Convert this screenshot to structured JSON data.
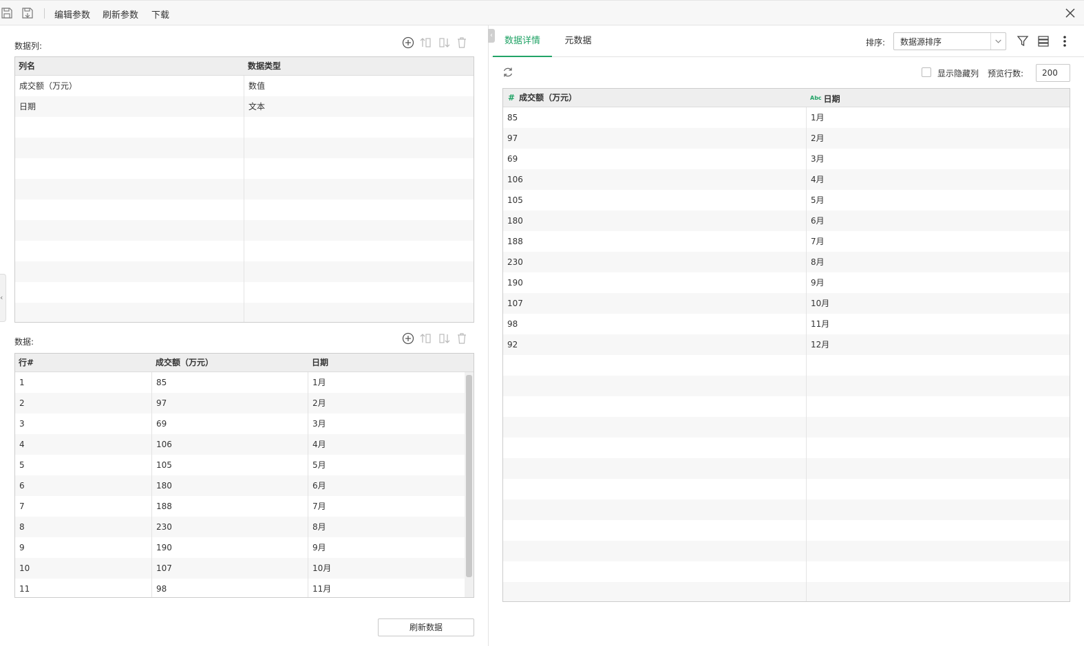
{
  "toolbar": {
    "save_icon": "save-icon",
    "save_as_icon": "save-as-icon",
    "edit_params": "编辑参数",
    "refresh_params": "刷新参数",
    "download": "下载"
  },
  "left": {
    "columns_label": "数据列:",
    "columns_header": [
      "列名",
      "数据类型"
    ],
    "columns_rows": [
      {
        "name": "成交额（万元）",
        "type": "数值"
      },
      {
        "name": "日期",
        "type": "文本"
      }
    ],
    "data_label": "数据:",
    "data_header": [
      "行#",
      "成交额（万元）",
      "日期"
    ],
    "data_rows": [
      {
        "row": "1",
        "amount": "85",
        "date": "1月"
      },
      {
        "row": "2",
        "amount": "97",
        "date": "2月"
      },
      {
        "row": "3",
        "amount": "69",
        "date": "3月"
      },
      {
        "row": "4",
        "amount": "106",
        "date": "4月"
      },
      {
        "row": "5",
        "amount": "105",
        "date": "5月"
      },
      {
        "row": "6",
        "amount": "180",
        "date": "6月"
      },
      {
        "row": "7",
        "amount": "188",
        "date": "7月"
      },
      {
        "row": "8",
        "amount": "230",
        "date": "8月"
      },
      {
        "row": "9",
        "amount": "190",
        "date": "9月"
      },
      {
        "row": "10",
        "amount": "107",
        "date": "10月"
      },
      {
        "row": "11",
        "amount": "98",
        "date": "11月"
      }
    ],
    "refresh_data_button": "刷新数据"
  },
  "right": {
    "tabs": [
      "数据详情",
      "元数据"
    ],
    "active_tab": "数据详情",
    "sort_label": "排序:",
    "sort_value": "数据源排序",
    "show_hidden_label": "显示隐藏列",
    "preview_rows_label": "预览行数:",
    "preview_rows_value": "200",
    "grid_header": {
      "amount": "成交额（万元）",
      "amount_type": "#",
      "date": "日期",
      "date_type": "Abc"
    },
    "grid_rows": [
      {
        "amount": "85",
        "date": "1月"
      },
      {
        "amount": "97",
        "date": "2月"
      },
      {
        "amount": "69",
        "date": "3月"
      },
      {
        "amount": "106",
        "date": "4月"
      },
      {
        "amount": "105",
        "date": "5月"
      },
      {
        "amount": "180",
        "date": "6月"
      },
      {
        "amount": "188",
        "date": "7月"
      },
      {
        "amount": "230",
        "date": "8月"
      },
      {
        "amount": "190",
        "date": "9月"
      },
      {
        "amount": "107",
        "date": "10月"
      },
      {
        "amount": "98",
        "date": "11月"
      },
      {
        "amount": "92",
        "date": "12月"
      }
    ]
  },
  "colors": {
    "accent": "#21a366",
    "header_bg": "#eeeeee",
    "stripe": "#f7f7f7"
  }
}
